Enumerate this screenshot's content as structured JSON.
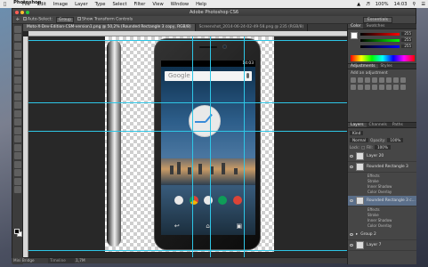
{
  "menubar": {
    "apple": "",
    "items": [
      "Photoshop",
      "File",
      "Edit",
      "Image",
      "Layer",
      "Type",
      "Select",
      "Filter",
      "View",
      "Window",
      "Help"
    ],
    "battery": "100%",
    "time": "14:03"
  },
  "window": {
    "title": "Adobe Photoshop CS6"
  },
  "options": {
    "auto_select": "Auto-Select:",
    "group": "Group",
    "transform": "Show Transform Controls",
    "essentials": "Essentials"
  },
  "tabs": [
    {
      "label": "Moto-X-Dev-Edition-CSM-version1.png @ 50,2% (Rounded Rectangle 3 copy, RGB/8)"
    },
    {
      "label": "Screenshot_2014-06-24-02-49-58.png @ 235 (RGB/8)"
    }
  ],
  "phone": {
    "status_time": "14:03",
    "search": "Google"
  },
  "status": {
    "zoom": "50.23%",
    "doc": "Doc: 3,09M/11,7M"
  },
  "timeline": "Mini Bridge",
  "timeline2": "Timeline",
  "panel": {
    "color_tabs": [
      "Color",
      "Swatches"
    ],
    "values": [
      "255",
      "255",
      "255"
    ],
    "adj_tabs": [
      "Adjustments",
      "Styles"
    ],
    "adj_label": "Add an adjustment",
    "layer_tabs": [
      "Layers",
      "Channels",
      "Paths"
    ],
    "kind": "Kind",
    "blend": "Normal",
    "opacity_label": "Opacity:",
    "opacity": "100%",
    "lock_label": "Lock:",
    "fill_label": "Fill:",
    "fill": "100%",
    "layers": [
      {
        "name": "Layer 20"
      },
      {
        "name": "Rounded Rectangle 3"
      },
      {
        "name": "Rounded Rectangle 3 c..."
      },
      {
        "name": "Group 2"
      },
      {
        "name": "Layer 7"
      }
    ],
    "effects": [
      "Effects",
      "Stroke",
      "Inner Shadow",
      "Color Overlay"
    ],
    "effects2": [
      "Effects",
      "Stroke",
      "Inner Shadow",
      "Color Overlay"
    ]
  },
  "colors": {
    "guide": "#2ec6e6",
    "selected_layer": "#5b6f8a"
  }
}
